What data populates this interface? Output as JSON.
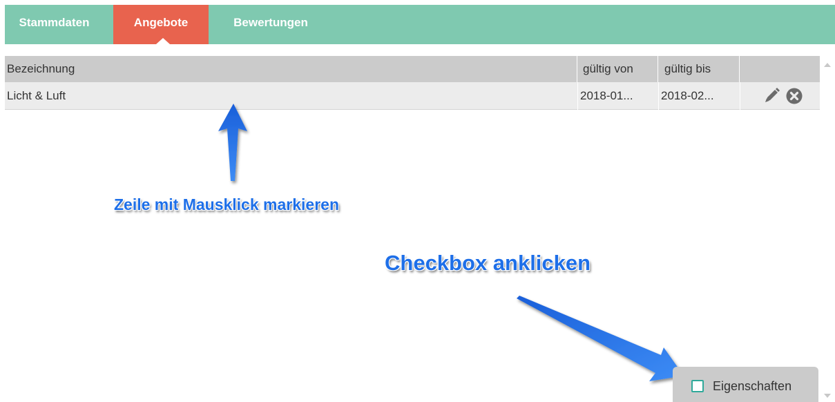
{
  "tabs": [
    {
      "label": "Stammdaten"
    },
    {
      "label": "Angebote",
      "active": true
    },
    {
      "label": "Bewertungen"
    }
  ],
  "colors": {
    "tabbar": "#7fc9b0",
    "active_tab": "#e8634e",
    "annotation": "#1e6fe8"
  },
  "table": {
    "headers": [
      "Bezeichnung",
      "gültig von",
      "gültig bis",
      ""
    ],
    "rows": [
      {
        "name": "Licht & Luft",
        "from": "2018-01...",
        "to": "2018-02...",
        "actions": [
          "pencil-icon",
          "close-circle-icon"
        ]
      }
    ]
  },
  "annotations": {
    "row_hint": "Zeile mit Mausklick markieren",
    "checkbox_hint": "Checkbox anklicken"
  },
  "checkbox": {
    "label": "Eigenschaften",
    "checked": false
  }
}
